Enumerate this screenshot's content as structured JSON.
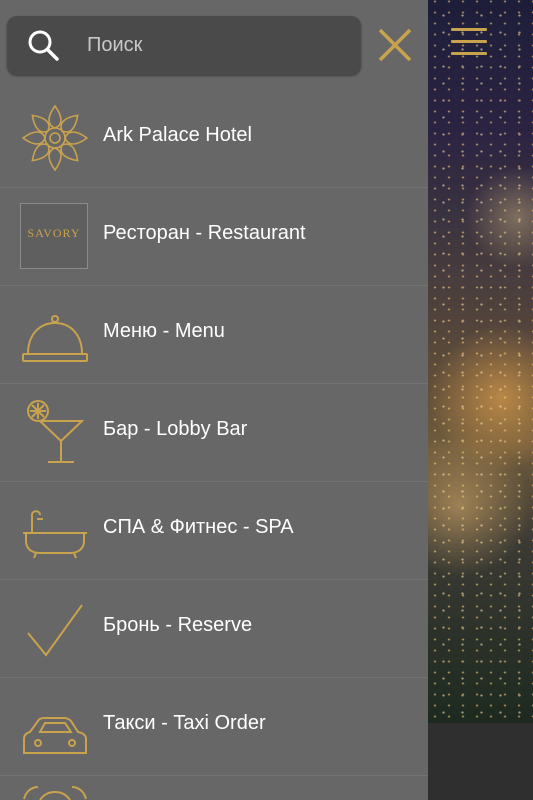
{
  "colors": {
    "drawer_bg": "#676767",
    "accent": "#c9a24e",
    "text": "#ffffff"
  },
  "search": {
    "placeholder": "Поиск"
  },
  "menu": [
    {
      "label": "Ark Palace Hotel",
      "icon": "hotel-logo-icon"
    },
    {
      "label": "Ресторан - Restaurant",
      "icon": "savory-logo",
      "logo_text": "SAVORY"
    },
    {
      "label": "Меню - Menu",
      "icon": "cloche-icon"
    },
    {
      "label": "Бар - Lobby Bar",
      "icon": "cocktail-icon"
    },
    {
      "label": "СПА & Фитнес - SPA",
      "icon": "bathtub-icon"
    },
    {
      "label": "Бронь - Reserve",
      "icon": "checkmark-icon"
    },
    {
      "label": "Такси - Taxi Order",
      "icon": "car-icon"
    }
  ]
}
